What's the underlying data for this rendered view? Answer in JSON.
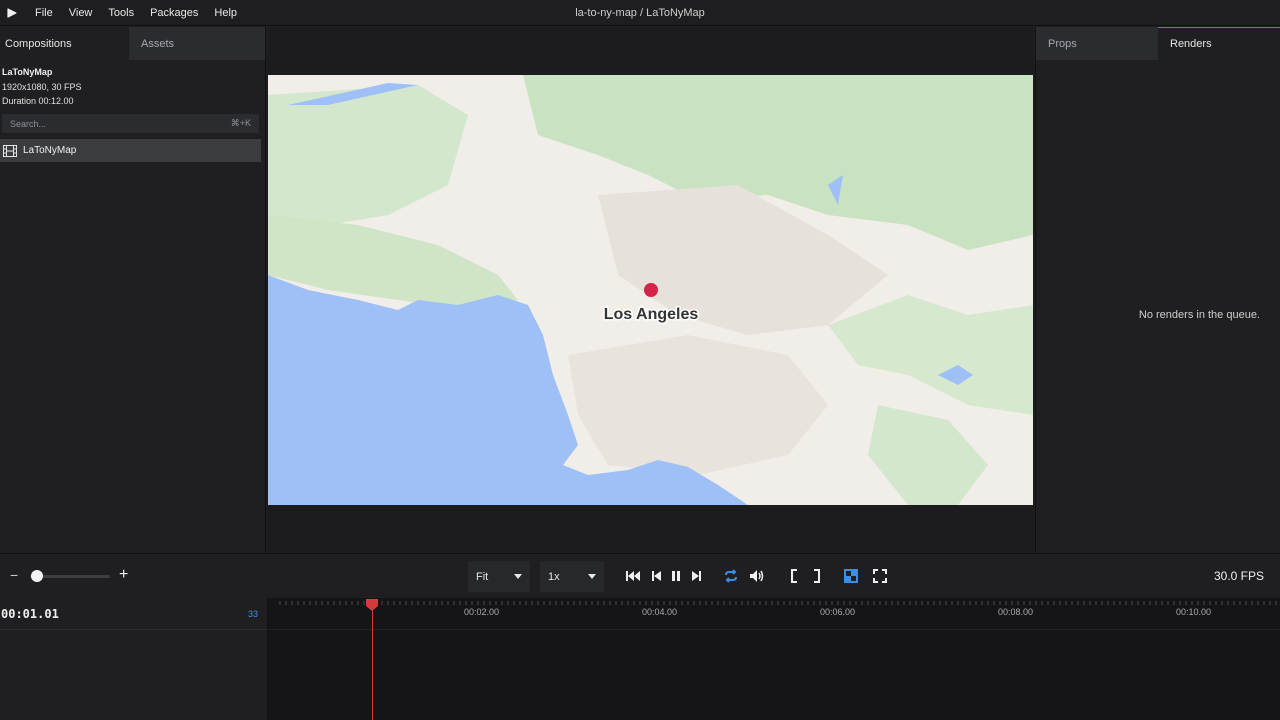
{
  "menubar": {
    "items": [
      "File",
      "View",
      "Tools",
      "Packages",
      "Help"
    ],
    "title": "la-to-ny-map / LaToNyMap"
  },
  "left_panel": {
    "tabs": [
      "Compositions",
      "Assets"
    ],
    "composition": {
      "name": "LaToNyMap",
      "resolution": "1920x1080, 30 FPS",
      "duration": "Duration 00:12.00"
    },
    "search": {
      "placeholder": "Search...",
      "shortcut": "⌘+K"
    },
    "list": [
      {
        "label": "LaToNyMap"
      }
    ]
  },
  "preview": {
    "map_label": "Los Angeles",
    "marker_color": "#d6234a",
    "water_color": "#9fc0f7",
    "land_color": "#f1eee9",
    "green_color": "#c8e0c0"
  },
  "right_panel": {
    "tabs": [
      "Props",
      "Renders"
    ],
    "empty_message": "No renders in the queue."
  },
  "controls": {
    "zoom_minus": "−",
    "zoom_plus": "+",
    "zoom_level": 0.08,
    "fit_select": "Fit",
    "speed_select": "1x",
    "icons": [
      "jump-to-start-icon",
      "step-back-icon",
      "pause-icon",
      "step-forward-icon",
      "loop-icon",
      "volume-icon",
      "in-point-icon",
      "out-point-icon",
      "checkerboard-icon",
      "fullscreen-icon"
    ],
    "accent_color": "#3a8ee6",
    "fps": "30.0 FPS"
  },
  "timeline": {
    "timecode": "00:01.01",
    "frame": "33",
    "labels": [
      "00:02.00",
      "00:04.00",
      "00:06.00",
      "00:08.00",
      "00:10.00"
    ],
    "playhead_color": "#d63a3a"
  }
}
